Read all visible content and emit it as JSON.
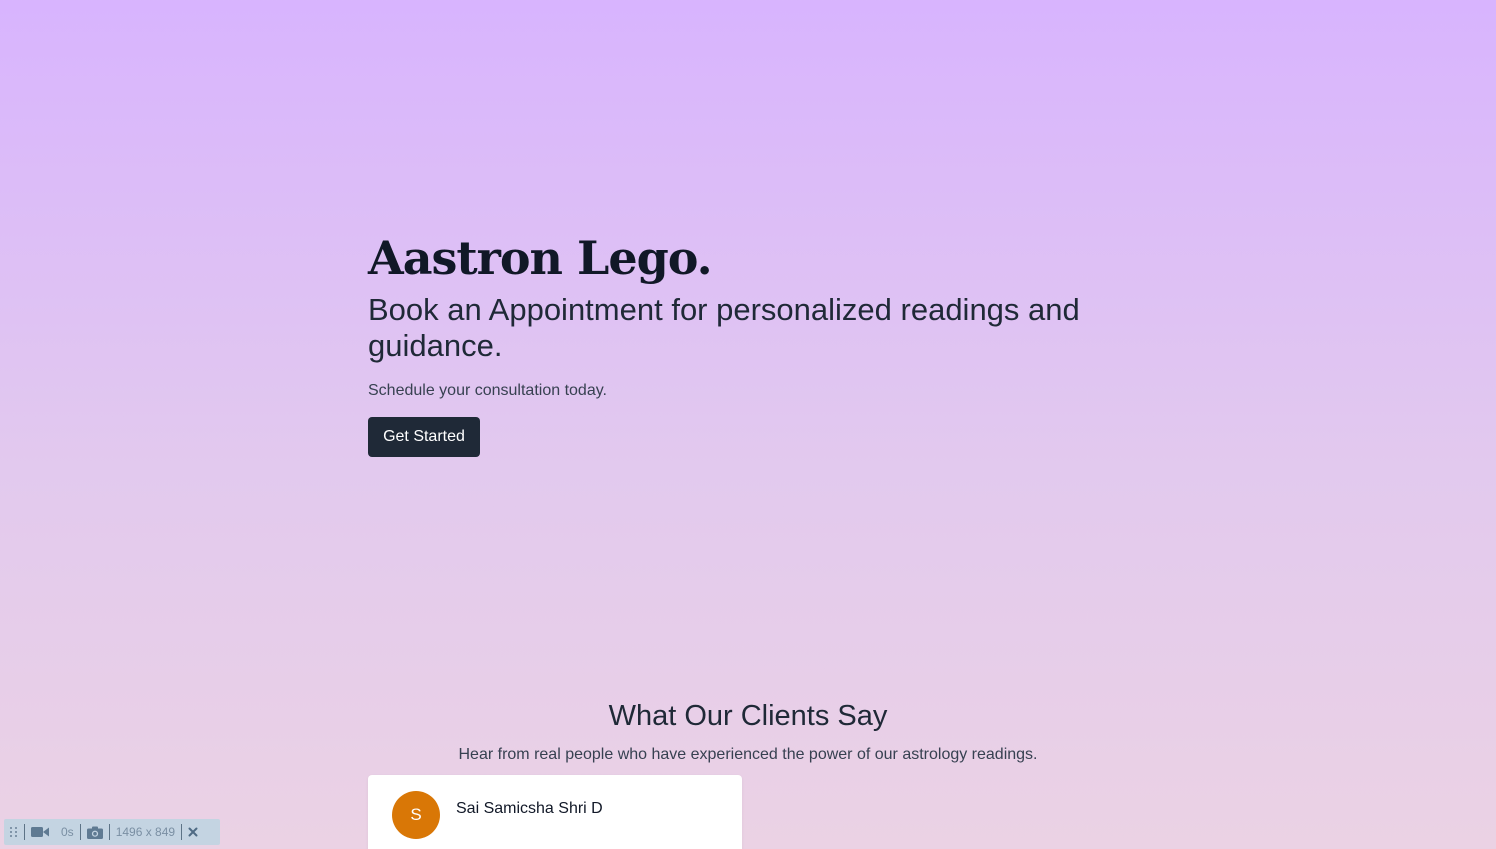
{
  "hero": {
    "brand": "Aastron Lego.",
    "headline": "Book an Appointment for personalized readings and guidance.",
    "subtext": "Schedule your consultation today.",
    "cta_label": "Get Started"
  },
  "testimonials": {
    "title": "What Our Clients Say",
    "subtitle": "Hear from real people who have experienced the power of our astrology readings.",
    "cards": [
      {
        "initial": "S",
        "name": "Sai Samicsha Shri D"
      }
    ]
  },
  "recorder": {
    "timer": "0s",
    "dimensions": "1496 x 849",
    "icons": [
      "drag-handle-icon",
      "video-camera-icon",
      "camera-icon",
      "close-icon"
    ]
  },
  "colors": {
    "accent_dark": "#1f2937",
    "avatar": "#d97706",
    "gradient_top": "#d8b4fe",
    "gradient_bottom": "#ebd2e4"
  }
}
